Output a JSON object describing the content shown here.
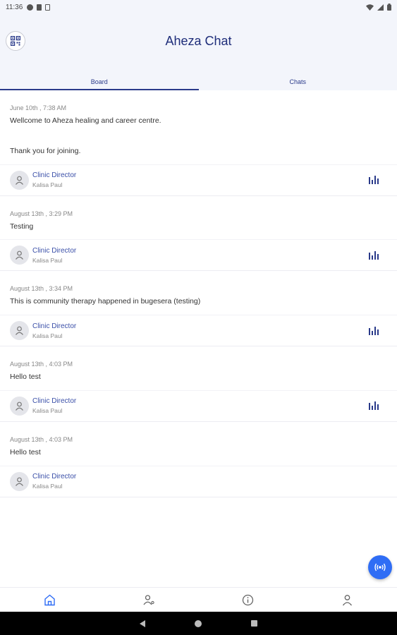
{
  "status_bar": {
    "time": "11:36"
  },
  "header": {
    "title": "Aheza Chat"
  },
  "tabs": [
    {
      "label": "Board",
      "active": true
    },
    {
      "label": "Chats",
      "active": false
    }
  ],
  "posts": [
    {
      "date": "June 10th , 7:38 AM",
      "lines": [
        "Wellcome to Aheza healing and career centre.",
        "Thank you for joining."
      ],
      "author_role": "Clinic Director",
      "author_name": "Kalisa Paul",
      "has_stats": true
    },
    {
      "date": "August 13th , 3:29 PM",
      "lines": [
        "Testing"
      ],
      "author_role": "Clinic Director",
      "author_name": "Kalisa Paul",
      "has_stats": true
    },
    {
      "date": "August 13th , 3:34 PM",
      "lines": [
        "This is community therapy happened in bugesera (testing)"
      ],
      "author_role": "Clinic Director",
      "author_name": "Kalisa Paul",
      "has_stats": true
    },
    {
      "date": "August 13th , 4:03 PM",
      "lines": [
        "Hello test"
      ],
      "author_role": "Clinic Director",
      "author_name": "Kalisa Paul",
      "has_stats": true
    },
    {
      "date": "August 13th , 4:03 PM",
      "lines": [
        "Hello test"
      ],
      "author_role": "Clinic Director",
      "author_name": "Kalisa Paul",
      "has_stats": false
    }
  ],
  "bottom_nav": [
    {
      "icon": "home-icon",
      "active": true
    },
    {
      "icon": "group-icon",
      "active": false
    },
    {
      "icon": "info-icon",
      "active": false
    },
    {
      "icon": "profile-icon",
      "active": false
    }
  ],
  "colors": {
    "accent": "#2a3a8a",
    "fab": "#2f6df5",
    "header_bg": "#f3f5fb"
  }
}
